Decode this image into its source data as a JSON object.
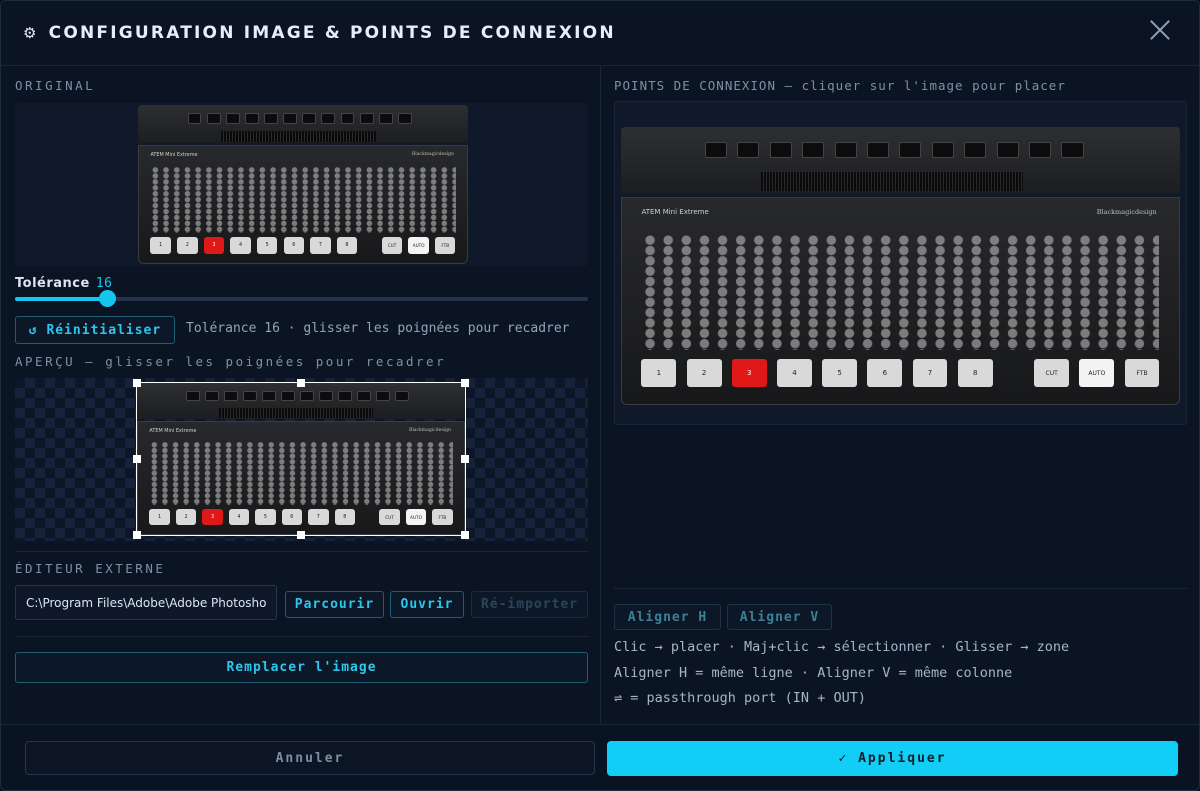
{
  "dialog": {
    "title": "CONFIGURATION IMAGE & POINTS DE CONNEXION",
    "icon": "gear-icon"
  },
  "left": {
    "original_label": "ORIGINAL",
    "tolerance": {
      "label": "Tolérance",
      "value": "16",
      "fraction": 0.16
    },
    "reset_button": "↺ Réinitialiser",
    "tolerance_hint": "Tolérance 16 · glisser les poignées pour recadrer",
    "preview_label": "APERÇU — glisser les poignées pour recadrer",
    "external_editor_label": "ÉDITEUR EXTERNE",
    "editor_path": "C:\\Program Files\\Adobe\\Adobe Photoshop",
    "browse_button": "Parcourir",
    "open_button": "Ouvrir",
    "reimport_button": "Ré-importer",
    "replace_button": "Remplacer l'image"
  },
  "right": {
    "points_label": "POINTS DE CONNEXION — cliquer sur l'image pour placer",
    "align_h_button": "Aligner H",
    "align_v_button": "Aligner V",
    "instructions": [
      "Clic → placer · Maj+clic → sélectionner · Glisser → zone",
      "Aligner H = même ligne · Aligner V = même colonne",
      "⇌ = passthrough port (IN + OUT)"
    ]
  },
  "device": {
    "name": "ATEM Mini Extreme",
    "brand": "Blackmagicdesign",
    "big_buttons": [
      "1",
      "2",
      "3",
      "4",
      "5",
      "6",
      "7",
      "8"
    ],
    "transition_buttons": [
      "CUT",
      "AUTO",
      "FTB"
    ]
  },
  "footer": {
    "cancel_button": "Annuler",
    "apply_button": "✓ Appliquer"
  },
  "colors": {
    "accent": "#12cdf5",
    "background": "#0b1422"
  }
}
